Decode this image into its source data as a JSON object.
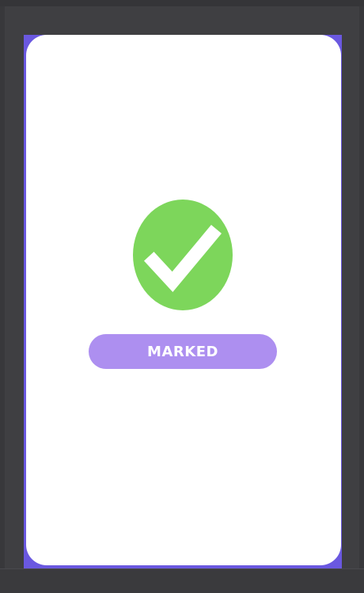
{
  "status": {
    "label": "MARKED",
    "icon": "check-circle-icon"
  },
  "colors": {
    "background": "#3f3f42",
    "accent": "#6a58e0",
    "card": "#ffffff",
    "success": "#7dd65b",
    "pill": "#ad8ff0",
    "pill_text": "#ffffff"
  }
}
